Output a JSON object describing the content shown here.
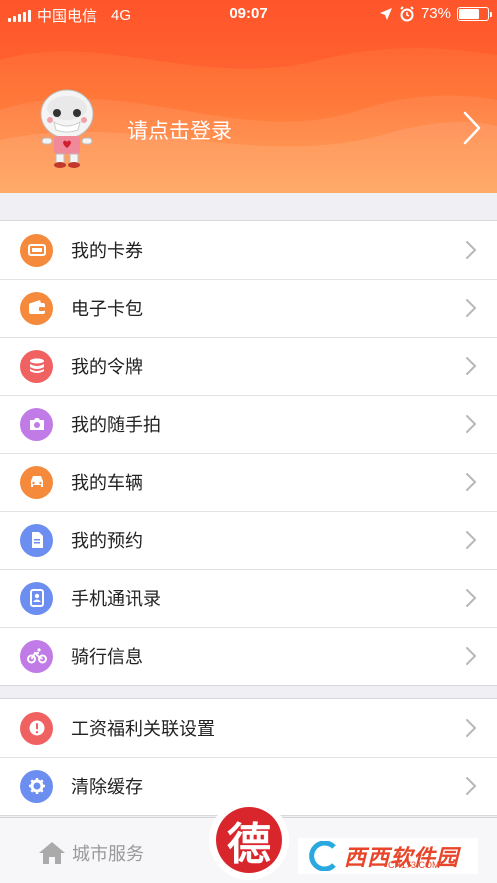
{
  "status_bar": {
    "carrier": "中国电信",
    "network": "4G",
    "time": "09:07",
    "battery_percent_text": "73%",
    "battery_level": 0.73
  },
  "header": {
    "login_text": "请点击登录",
    "gradient_colors": [
      "#ff5a2e",
      "#ff9a4a"
    ]
  },
  "menu": [
    {
      "label": "我的卡券",
      "icon": "card-icon",
      "color": "#f58a3c"
    },
    {
      "label": "电子卡包",
      "icon": "wallet-icon",
      "color": "#f58a3c"
    },
    {
      "label": "我的令牌",
      "icon": "database-icon",
      "color": "#f06262"
    },
    {
      "label": "我的随手拍",
      "icon": "camera-icon",
      "color": "#c07be6"
    },
    {
      "label": "我的车辆",
      "icon": "car-icon",
      "color": "#f58a3c"
    },
    {
      "label": "我的预约",
      "icon": "document-icon",
      "color": "#6b8ef0"
    },
    {
      "label": "手机通讯录",
      "icon": "contacts-icon",
      "color": "#6b8ef0"
    },
    {
      "label": "骑行信息",
      "icon": "bicycle-icon",
      "color": "#c07be6"
    }
  ],
  "menu2": [
    {
      "label": "工资福利关联设置",
      "icon": "alert-icon",
      "color": "#f06262"
    },
    {
      "label": "清除缓存",
      "icon": "gear-icon",
      "color": "#6b8ef0"
    }
  ],
  "tabbar": {
    "home_label": "城市服务",
    "center_glyph": "德"
  },
  "watermark": {
    "text": "西西软件园",
    "sub": "CR173.COM"
  }
}
